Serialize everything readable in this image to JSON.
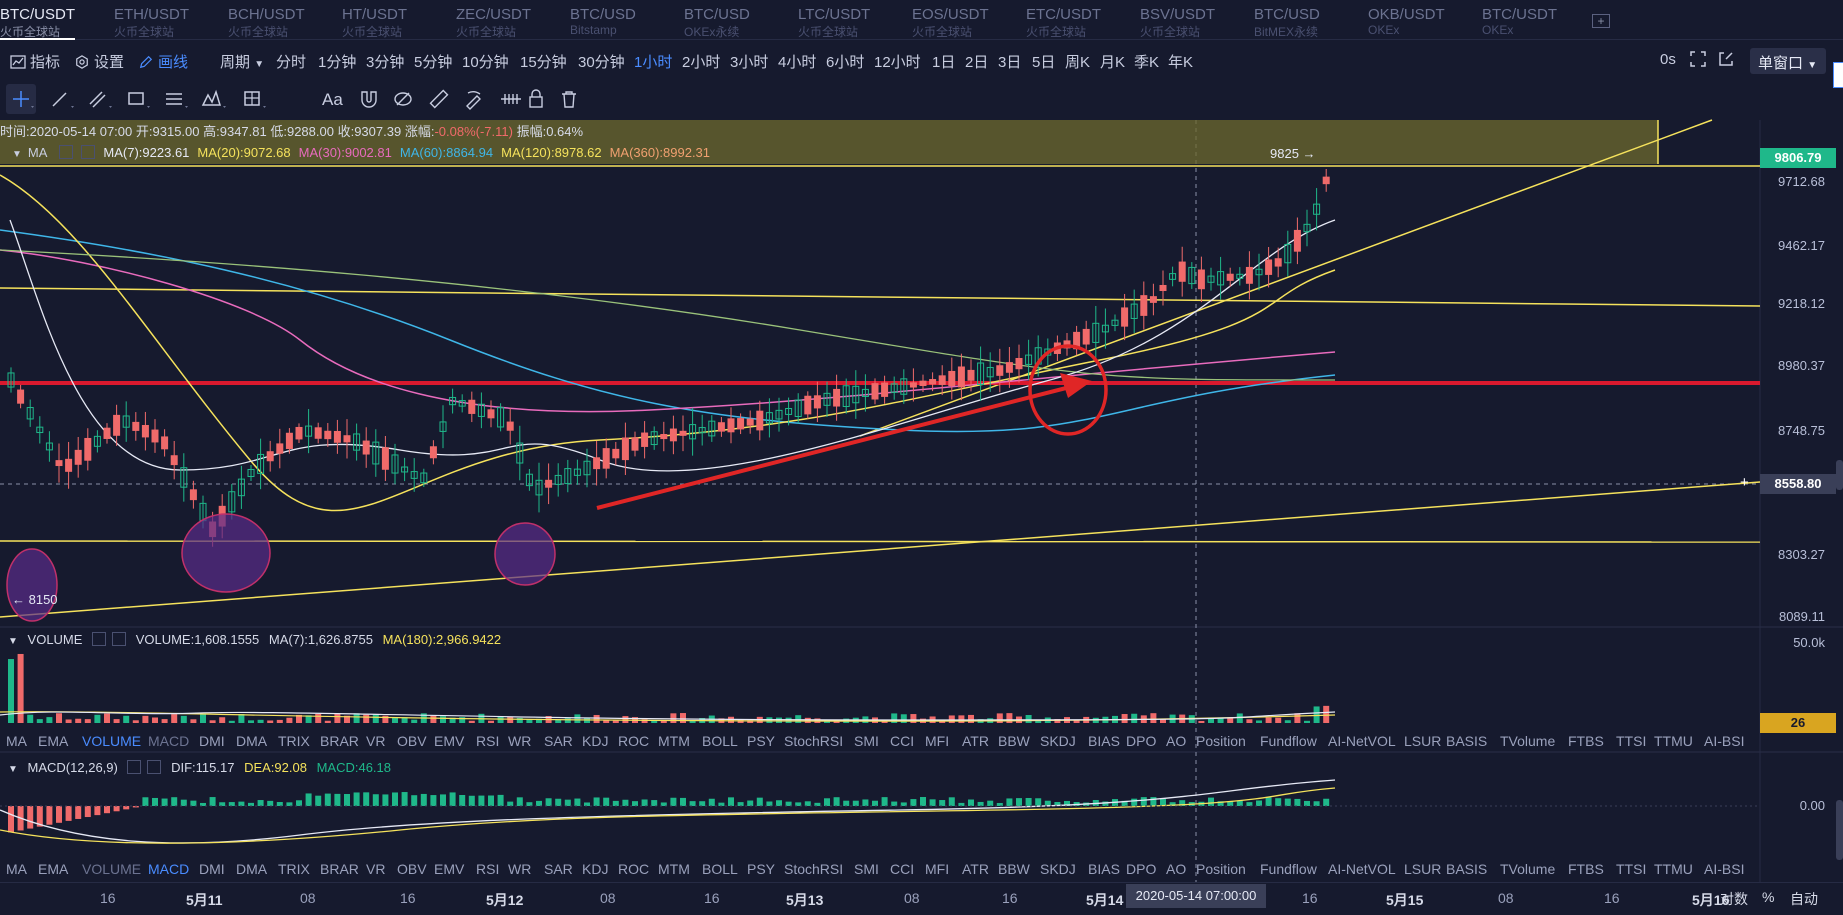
{
  "tabs": [
    {
      "name": "BTC/USDT",
      "exchange": "火币全球站",
      "active": true
    },
    {
      "name": "ETH/USDT",
      "exchange": "火币全球站"
    },
    {
      "name": "BCH/USDT",
      "exchange": "火币全球站"
    },
    {
      "name": "HT/USDT",
      "exchange": "火币全球站"
    },
    {
      "name": "ZEC/USDT",
      "exchange": "火币全球站"
    },
    {
      "name": "BTC/USD",
      "exchange": "Bitstamp"
    },
    {
      "name": "BTC/USD",
      "exchange": "OKEx永续"
    },
    {
      "name": "LTC/USDT",
      "exchange": "火币全球站"
    },
    {
      "name": "EOS/USDT",
      "exchange": "火币全球站"
    },
    {
      "name": "ETC/USDT",
      "exchange": "火币全球站"
    },
    {
      "name": "BSV/USDT",
      "exchange": "火币全球站"
    },
    {
      "name": "BTC/USD",
      "exchange": "BitMEX永续"
    },
    {
      "name": "OKB/USDT",
      "exchange": "OKEx"
    },
    {
      "name": "BTC/USDT",
      "exchange": "OKEx"
    }
  ],
  "tab_add": "+",
  "toolbar": {
    "indicators": "指标",
    "settings": "设置",
    "draw": "画线",
    "period": "周期",
    "intervals": [
      "分时",
      "1分钟",
      "3分钟",
      "5分钟",
      "10分钟",
      "15分钟",
      "30分钟",
      "1小时",
      "2小时",
      "3小时",
      "4小时",
      "6小时",
      "12小时",
      "1日",
      "2日",
      "3日",
      "5日",
      "周K",
      "月K",
      "季K",
      "年K"
    ],
    "active_interval": "1小时",
    "countdown": "0s",
    "window_mode": "单窗口"
  },
  "draw_tools": [
    "crosshair-icon",
    "line-icon",
    "parallel-line-icon",
    "rectangle-icon",
    "fib-icon",
    "pattern-icon",
    "measure-icon",
    "text-icon",
    "magnet-icon",
    "hide-icon",
    "ruler-icon",
    "brush-icon",
    "wave-icon",
    "lock-icon",
    "trash-icon"
  ],
  "text_tool": "Aa",
  "ohlc": {
    "time": "时间:2020-05-14 07:00",
    "open": "开:9315.00",
    "high": "高:9347.81",
    "low": "低:9288.00",
    "close": "收:9307.39",
    "change_label": "涨幅:",
    "change": "-0.08%(-7.11)",
    "amplitude": "振幅:0.64%"
  },
  "ma": {
    "label": "MA",
    "values": [
      {
        "text": "MA(7):9223.61",
        "color": "#e6e9f5"
      },
      {
        "text": "MA(20):9072.68",
        "color": "#f5e25c"
      },
      {
        "text": "MA(30):9002.81",
        "color": "#e86bbd"
      },
      {
        "text": "MA(60):8864.94",
        "color": "#3fb6e8"
      },
      {
        "text": "MA(120):8978.62",
        "color": "#f5e25c"
      },
      {
        "text": "MA(360):8992.31",
        "color": "#f0a070"
      }
    ]
  },
  "price_axis": [
    "9712.68",
    "9462.17",
    "9218.12",
    "8980.37",
    "8748.75",
    "8303.27",
    "8089.11"
  ],
  "price_tags": {
    "last": "9806.79",
    "crosshair": "8558.80",
    "high_marker": "9825 →",
    "low_marker": "← 8150"
  },
  "volume": {
    "label": "VOLUME",
    "value": "VOLUME:1,608.1555",
    "ma7": "MA(7):1,626.8755",
    "ma180": "MA(180):2,966.9422",
    "axis_top": "50.0k",
    "tag": "26"
  },
  "indicator_bar": [
    "MA",
    "EMA",
    "VOLUME",
    "MACD",
    "DMI",
    "DMA",
    "TRIX",
    "BRAR",
    "VR",
    "OBV",
    "EMV",
    "RSI",
    "WR",
    "SAR",
    "KDJ",
    "ROC",
    "MTM",
    "BOLL",
    "PSY",
    "StochRSI",
    "SMI",
    "CCI",
    "MFI",
    "ATR",
    "BBW",
    "SKDJ",
    "BIAS",
    "DPO",
    "AO",
    "Position",
    "Fundflow",
    "AI-NetVOL",
    "LSUR",
    "BASIS",
    "TVolume",
    "FTBS",
    "TTSI",
    "TTMU",
    "AI-BSI"
  ],
  "macd": {
    "label": "MACD(12,26,9)",
    "dif": "DIF:115.17",
    "dea": "DEA:92.08",
    "macd": "MACD:46.18",
    "axis_zero": "0.00"
  },
  "time_axis": [
    {
      "t": "16",
      "bold": false
    },
    {
      "t": "5月11",
      "bold": true
    },
    {
      "t": "08",
      "bold": false
    },
    {
      "t": "16",
      "bold": false
    },
    {
      "t": "5月12",
      "bold": true
    },
    {
      "t": "08",
      "bold": false
    },
    {
      "t": "16",
      "bold": false
    },
    {
      "t": "5月13",
      "bold": true
    },
    {
      "t": "08",
      "bold": false
    },
    {
      "t": "16",
      "bold": false
    },
    {
      "t": "5月14",
      "bold": true
    },
    {
      "t": "16",
      "bold": false
    },
    {
      "t": "5月15",
      "bold": true
    },
    {
      "t": "08",
      "bold": false
    },
    {
      "t": "16",
      "bold": false
    },
    {
      "t": "5月16",
      "bold": true
    }
  ],
  "crosshair_time": "2020-05-14 07:00:00",
  "corner": {
    "log": "对数",
    "percent": "%",
    "auto": "自动"
  }
}
